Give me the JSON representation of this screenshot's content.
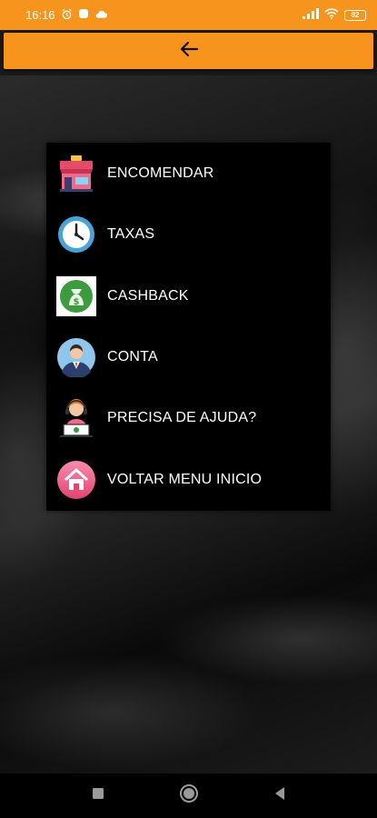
{
  "status_bar": {
    "time": "16:16",
    "battery": "82"
  },
  "toolbar": {
    "back_icon": "arrow-left-icon",
    "color": "#f7941d"
  },
  "menu": {
    "items": [
      {
        "label": "ENCOMENDAR",
        "icon": "store-icon"
      },
      {
        "label": "TAXAS",
        "icon": "clock-icon"
      },
      {
        "label": "CASHBACK",
        "icon": "money-bag-icon"
      },
      {
        "label": "CONTA",
        "icon": "user-avatar-icon"
      },
      {
        "label": "PRECISA DE AJUDA?",
        "icon": "support-agent-icon"
      },
      {
        "label": "VOLTAR MENU INICIO",
        "icon": "home-icon"
      }
    ]
  },
  "nav_bar": {
    "items": [
      "recent-apps-icon",
      "home-circle-icon",
      "back-triangle-icon"
    ]
  }
}
